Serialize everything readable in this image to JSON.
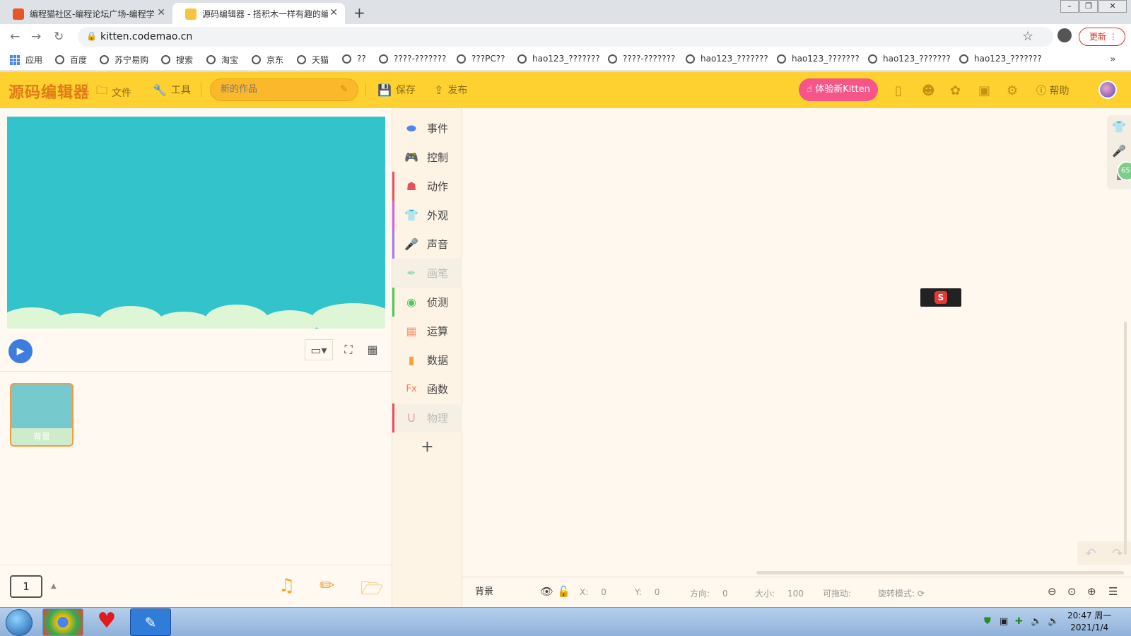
{
  "browser": {
    "tabs": [
      {
        "title": "编程猫社区-编程论坛广场-编程学",
        "active": false
      },
      {
        "title": "源码编辑器 - 搭积木一样有趣的编",
        "active": true
      }
    ],
    "url": "kitten.codemao.cn",
    "update_label": "更新",
    "apps_label": "应用",
    "bookmarks": [
      "百度",
      "苏宁易购",
      "搜索",
      "淘宝",
      "京东",
      "天猫",
      "??",
      "????-???????",
      "???PC??",
      "hao123_???????",
      "????-???????",
      "hao123_???????",
      "hao123_???????",
      "hao123_???????",
      "hao123_???????"
    ]
  },
  "app": {
    "logo": "源码编辑器",
    "menu_file": "文件",
    "menu_tools": "工具",
    "project_name_placeholder": "新的作品",
    "save_label": "保存",
    "publish_label": "发布",
    "try_kitten_label": "体验新Kitten",
    "help_label": "帮助"
  },
  "categories": [
    {
      "label": "事件",
      "color": "#4f86e8",
      "icon": "toggle-icon",
      "enabled": true
    },
    {
      "label": "控制",
      "color": "#46b4e8",
      "icon": "gamepad-icon",
      "enabled": true
    },
    {
      "label": "动作",
      "color": "#e8505b",
      "icon": "ghost-icon",
      "enabled": true
    },
    {
      "label": "外观",
      "color": "#d65fe0",
      "icon": "shirt-icon",
      "enabled": true
    },
    {
      "label": "声音",
      "color": "#a678e8",
      "icon": "microphone-icon",
      "enabled": true
    },
    {
      "label": "画笔",
      "color": "#9bd8b8",
      "icon": "pen-icon",
      "enabled": false
    },
    {
      "label": "侦测",
      "color": "#4ccb5a",
      "icon": "target-icon",
      "enabled": true
    },
    {
      "label": "运算",
      "color": "#f39c7a",
      "icon": "calculator-icon",
      "enabled": true
    },
    {
      "label": "数据",
      "color": "#f0a63c",
      "icon": "bar-chart-icon",
      "enabled": true
    },
    {
      "label": "函数",
      "color": "#f07e5a",
      "icon": "function-icon",
      "enabled": true
    },
    {
      "label": "物理",
      "color": "#e8a0a8",
      "icon": "magnet-icon",
      "enabled": false
    }
  ],
  "stage": {
    "background_color": "#33c3cb",
    "sprite_card_label": "背景",
    "screen_count": "1"
  },
  "properties": {
    "name": "背景",
    "x_label": "X:",
    "x_value": "0",
    "y_label": "Y:",
    "y_value": "0",
    "direction_label": "方向:",
    "direction_value": "0",
    "size_label": "大小:",
    "size_value": "100",
    "draggable_label": "可拖动:",
    "rotation_label": "旋转模式:"
  },
  "side_badge": "65",
  "taskbar": {
    "time": "20:47 周一",
    "date": "2021/1/4"
  }
}
